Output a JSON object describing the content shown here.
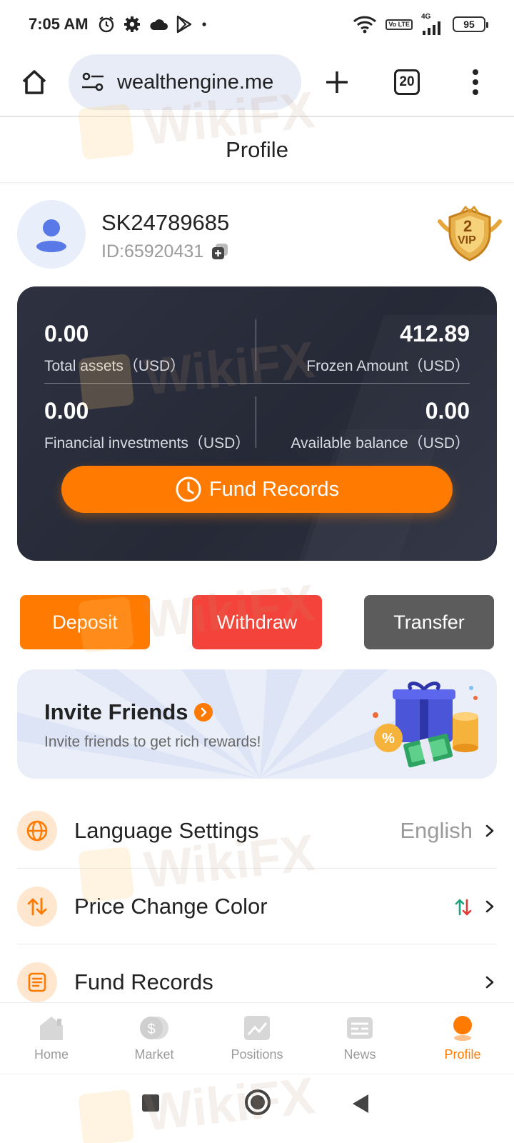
{
  "status_bar": {
    "time": "7:05 AM",
    "battery": "95",
    "network": "4G",
    "lte_badge": "Vo LTE",
    "icons": [
      "alarm-icon",
      "gear-icon",
      "cloud-icon",
      "play-store-icon",
      "dot-icon",
      "wifi-icon",
      "signal-icon",
      "battery-icon"
    ]
  },
  "browser": {
    "url": "wealthengine.me",
    "tab_count": "20",
    "icons": [
      "home-icon",
      "site-settings-icon",
      "new-tab-icon",
      "tabs-icon",
      "more-icon"
    ]
  },
  "page": {
    "title": "Profile"
  },
  "user": {
    "username": "SK24789685",
    "id_text": "ID:65920431",
    "vip_level": "2",
    "vip_label": "VIP"
  },
  "assets": {
    "total_assets_value": "0.00",
    "total_assets_label": "Total assets（USD）",
    "frozen_value": "412.89",
    "frozen_label": "Frozen Amount（USD）",
    "financial_value": "0.00",
    "financial_label": "Financial investments（USD）",
    "available_value": "0.00",
    "available_label": "Available balance（USD）",
    "fund_records_button": "Fund Records"
  },
  "actions": {
    "deposit": "Deposit",
    "withdraw": "Withdraw",
    "transfer": "Transfer"
  },
  "invite": {
    "title": "Invite Friends",
    "subtitle": "Invite friends to get rich rewards!"
  },
  "menu": {
    "language_label": "Language Settings",
    "language_value": "English",
    "price_color_label": "Price Change Color",
    "fund_records_label": "Fund Records"
  },
  "bottom_nav": {
    "home": "Home",
    "market": "Market",
    "positions": "Positions",
    "news": "News",
    "profile": "Profile"
  },
  "watermark": "WikiFX",
  "colors": {
    "accent": "#ff7a00",
    "withdraw": "#f4433a",
    "transfer": "#5c5c5c",
    "card_bg": "#2a2e3b",
    "price_up": "#1aa37a",
    "price_down": "#e53935"
  }
}
